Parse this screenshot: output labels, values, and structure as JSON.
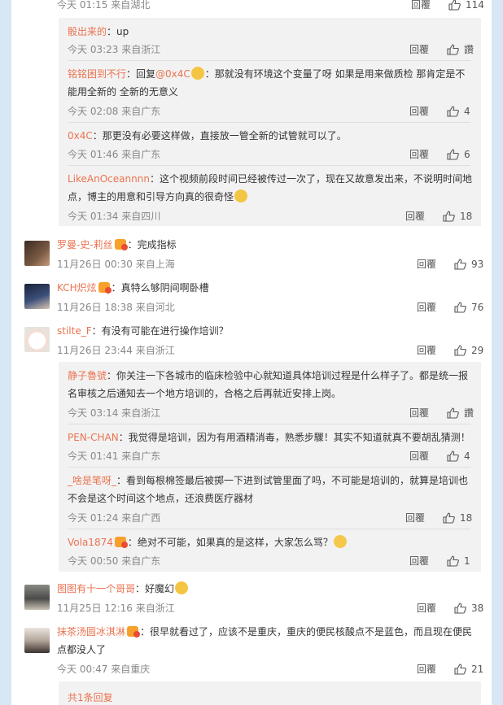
{
  "ui": {
    "reply_label": "回覆"
  },
  "top": {
    "meta": "今天 01:15 来自湖北",
    "likes": "114"
  },
  "replies_group1": [
    {
      "user": "骰出来的",
      "text": "：up",
      "meta": "今天 03:23 来自浙江",
      "likes": "讚"
    },
    {
      "user": "铭铭困到不行",
      "text_pre": "：回复",
      "mention": "@0x4C",
      "text": "：那就没有环境这个变量了呀 如果是用来做质检 那肯定是不能用全新的 全新的无意义",
      "meta": "今天 02:08 来自广东",
      "likes": "4"
    },
    {
      "user": "0x4C",
      "text": "：那更没有必要这样做，直接放一管全新的试管就可以了。",
      "meta": "今天 01:46 来自广东",
      "likes": "6"
    },
    {
      "user": "LikeAnOceannnn",
      "text": "：这个视频前段时间已经被传过一次了，现在又故意发出来，不说明时间地点，博主的用意和引导方向真的很奇怪",
      "meta": "今天 01:34 来自四川",
      "likes": "18"
    }
  ],
  "comments": [
    {
      "user": "罗曼-史-莉丝",
      "text": "：完成指标",
      "meta": "11月26日 00:30 来自上海",
      "likes": "93",
      "vip": true
    },
    {
      "user": "KCH炽炫",
      "text": "：真特么够阴间啊卧槽",
      "meta": "11月26日 18:38 来自河北",
      "likes": "76",
      "vip": true
    },
    {
      "user": "stilte_F",
      "text": "：有没有可能在进行操作培训？",
      "meta": "11月26日 23:44 来自浙江",
      "likes": "29",
      "vip": false
    }
  ],
  "replies_group2": [
    {
      "user": "静子魯號",
      "text": "：你关注一下各城市的临床检验中心就知道具体培训过程是什么样子了。都是统一报名审核之后通知去一个地方培训的，合格之后再就近安排上岗。",
      "meta": "今天 03:14 来自浙江",
      "likes": "讚"
    },
    {
      "user": "PEN-CHAN",
      "text": "：我觉得是培训，因为有用酒精消毒，熟悉步驟！其实不知道就真不要胡乱猜测！",
      "meta": "今天 01:41 来自广东",
      "likes": "4"
    },
    {
      "user": "_啥是笔呀_",
      "text": "：看到每根棉签最后被掷一下进到试管里面了吗，不可能是培训的，就算是培训也不会是这个时间这个地点，还浪费医疗器材",
      "meta": "今天 01:24 来自广西",
      "likes": "18"
    },
    {
      "user": "Vola1874",
      "text": "：绝对不可能，如果真的是这样，大家怎么骂？",
      "meta": "今天 00:50 来自广东",
      "likes": "1",
      "vip": true
    }
  ],
  "comments2": [
    {
      "user": "图图有十一个哥哥",
      "text": "：好魔幻",
      "meta": "11月25日 12:16 来自浙江",
      "likes": "38",
      "vip": false
    },
    {
      "user": "抹茶汤圆冰淇淋",
      "text": "：很早就看过了，应该不是重庆，重庆的便民核酸点不是蓝色，而且现在便民点都没人了",
      "meta": "今天 00:47 来自重庆",
      "likes": "21",
      "vip": true
    }
  ],
  "footer": {
    "more_replies": "共1条回复"
  },
  "colors": {
    "page_bg": "#d7e7f5",
    "reply_bg": "#f2f2f2",
    "username": "#eb7350",
    "meta": "#888888"
  }
}
